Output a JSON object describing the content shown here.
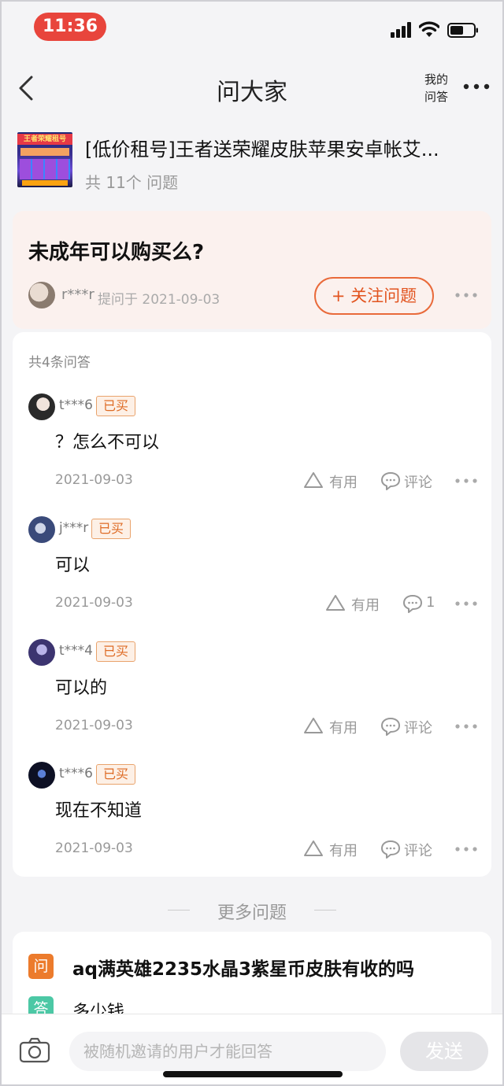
{
  "status_bar": {
    "time": "11:36"
  },
  "nav": {
    "title": "问大家",
    "my_answers_line1": "我的",
    "my_answers_line2": "问答"
  },
  "product": {
    "title": "[低价租号]王者送荣耀皮肤苹果安卓帐艾...",
    "question_count": "共 11个 问题",
    "thumb_text": "王者荣耀租号"
  },
  "question": {
    "text": "未成年可以购买么?",
    "user": "r***r",
    "asked_on": "提问于 2021-09-03",
    "follow_label": "+ 关注问题"
  },
  "answers_header": "共4条问答",
  "answers": [
    {
      "user": "t***6",
      "badge": "已买",
      "text": "？怎么不可以",
      "date": "2021-09-03",
      "useful_label": "有用",
      "comment_label": "评论"
    },
    {
      "user": "j***r",
      "badge": "已买",
      "text": "可以",
      "date": "2021-09-03",
      "useful_label": "有用",
      "comment_label": "1"
    },
    {
      "user": "t***4",
      "badge": "已买",
      "text": "可以的",
      "date": "2021-09-03",
      "useful_label": "有用",
      "comment_label": "评论"
    },
    {
      "user": "t***6",
      "badge": "已买",
      "text": "现在不知道",
      "date": "2021-09-03",
      "useful_label": "有用",
      "comment_label": "评论"
    }
  ],
  "more_questions": {
    "label": "更多问题",
    "q_icon": "问",
    "question": "aq满英雄2235水晶3紫星币皮肤有收的吗",
    "a_icon": "答",
    "answer_preview": "多少钱"
  },
  "bottom_bar": {
    "placeholder": "被随机邀请的用户才能回答",
    "send_label": "发送"
  },
  "icons": [
    "back-icon",
    "more-icon",
    "signal-icon",
    "wifi-icon",
    "battery-icon",
    "useful-icon",
    "comment-icon",
    "camera-icon"
  ],
  "colors": {
    "accent": "#e2541f",
    "badge_bg": "#fdf0e6",
    "question_card_bg": "#fbf1ee",
    "time_pill": "#e8453c"
  }
}
